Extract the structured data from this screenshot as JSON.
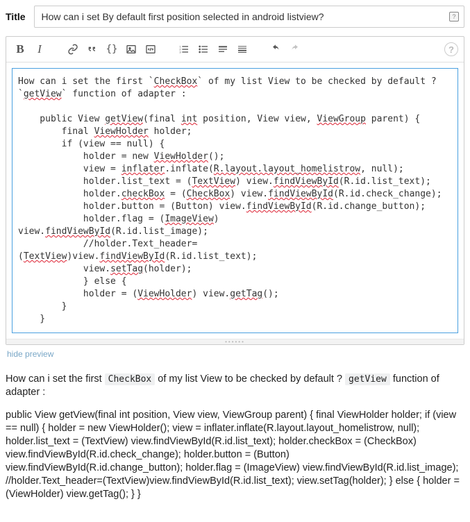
{
  "title": {
    "label": "Title",
    "value": "How can i set By default first position selected in android listview?"
  },
  "toolbar": {
    "bold": "B",
    "italic": "I"
  },
  "editor": {
    "l1a": "How can i set the first `",
    "l1b": "CheckBox",
    "l1c": "` of my list View to be checked by default ? ",
    "l2a": "`",
    "l2b": "getView",
    "l2c": "` function of adapter :",
    "blank1": "",
    "l3a": "    public View ",
    "l3b": "getView",
    "l3c": "(final ",
    "l3d": "int",
    "l3e": " position, View view, ",
    "l3f": "ViewGroup",
    "l3g": " parent) {",
    "l4a": "        final ",
    "l4b": "ViewHolder",
    "l4c": " holder;",
    "l5": "        if (view == null) {",
    "l6a": "            holder = new ",
    "l6b": "ViewHolder",
    "l6c": "();",
    "l7a": "            view = ",
    "l7b": "inflater",
    "l7c": ".inflate(",
    "l7d": "R.layout.layout_homelistrow",
    "l7e": ", null);",
    "l8a": "            holder.list_text = (",
    "l8b": "TextView",
    "l8c": ") view.",
    "l8d": "findViewById",
    "l8e": "(R.id.list_text);",
    "l9a": "            holder.",
    "l9b": "checkBox",
    "l9c": " = (",
    "l9d": "CheckBox",
    "l9e": ") view.",
    "l9f": "findViewById",
    "l9g": "(R.id.check_change);",
    "l10a": "            holder.button = (Button) view.",
    "l10b": "findViewById",
    "l10c": "(R.id.change_button);",
    "l11a": "            holder.flag = (",
    "l11b": "ImageView",
    "l11c": ") ",
    "l12a": "view.",
    "l12b": "findViewById",
    "l12c": "(R.id.list_image);",
    "l13": "            //holder.Text_header=",
    "l14a": "(",
    "l14b": "TextView",
    "l14c": ")view.",
    "l14d": "findViewById",
    "l14e": "(R.id.list_text);",
    "l15a": "            view.",
    "l15b": "setTag",
    "l15c": "(holder);",
    "l16": "            } else {",
    "l17a": "            holder = (",
    "l17b": "ViewHolder",
    "l17c": ") view.",
    "l17d": "getTag",
    "l17e": "();",
    "l18": "        }",
    "l19": "    }"
  },
  "preview_link": "hide preview",
  "preview": {
    "p1a": "How can i set the first ",
    "p1b": "CheckBox",
    "p1c": " of my list View to be checked by default ? ",
    "p1d": "getView",
    "p1e": " function of adapter :",
    "p2": "public View getView(final int position, View view, ViewGroup parent) { final ViewHolder holder; if (view == null) { holder = new ViewHolder(); view = inflater.inflate(R.layout.layout_homelistrow, null); holder.list_text = (TextView) view.findViewById(R.id.list_text); holder.checkBox = (CheckBox) view.findViewById(R.id.check_change); holder.button = (Button) view.findViewById(R.id.change_button); holder.flag = (ImageView) view.findViewById(R.id.list_image); //holder.Text_header=(TextView)view.findViewById(R.id.list_text); view.setTag(holder); } else { holder = (ViewHolder) view.getTag(); } }"
  }
}
